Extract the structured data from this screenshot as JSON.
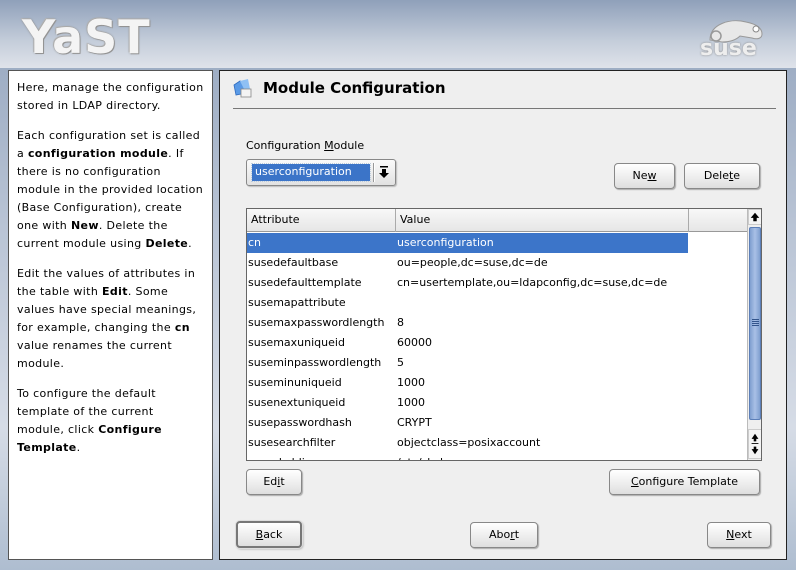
{
  "banner": {
    "app_logo": "YaST",
    "vendor_logo": "suse"
  },
  "help": {
    "paragraphs": [
      [
        {
          "t": "Here, manage the configuration stored in LDAP directory."
        }
      ],
      [
        {
          "t": "Each configuration set is called a "
        },
        {
          "b": "configuration module"
        },
        {
          "t": ". If there is no configuration module in the provided location (Base Configuration), create one with "
        },
        {
          "b": "New"
        },
        {
          "t": ". Delete the current module using "
        },
        {
          "b": "Delete"
        },
        {
          "t": "."
        }
      ],
      [
        {
          "t": "Edit the values of attributes in the table with "
        },
        {
          "b": "Edit"
        },
        {
          "t": ". Some values have special meanings, for example, changing the "
        },
        {
          "b": "cn"
        },
        {
          "t": " value renames the current module."
        }
      ],
      [
        {
          "t": "To configure the default template of the current module, click "
        },
        {
          "b": "Configure Template"
        },
        {
          "t": "."
        }
      ]
    ]
  },
  "main": {
    "title": "Module Configuration",
    "title_icon": "ldap-config-icon",
    "config_module": {
      "label_pre": "Configuration ",
      "label_mnemonic": "M",
      "label_post": "odule",
      "selected": "userconfiguration"
    },
    "buttons": {
      "new": {
        "pre": "Ne",
        "mn": "w",
        "post": ""
      },
      "delete": {
        "pre": "Dele",
        "mn": "t",
        "post": "e"
      },
      "edit": {
        "pre": "Ed",
        "mn": "i",
        "post": "t"
      },
      "configure_template": {
        "pre": "",
        "mn": "C",
        "post": "onfigure Template"
      }
    },
    "table": {
      "columns": [
        "Attribute",
        "Value"
      ],
      "selected_index": 0,
      "rows": [
        {
          "attribute": "cn",
          "value": "userconfiguration"
        },
        {
          "attribute": "susedefaultbase",
          "value": "ou=people,dc=suse,dc=de"
        },
        {
          "attribute": "susedefaulttemplate",
          "value": "cn=usertemplate,ou=ldapconfig,dc=suse,dc=de"
        },
        {
          "attribute": "susemapattribute",
          "value": ""
        },
        {
          "attribute": "susemaxpasswordlength",
          "value": "8"
        },
        {
          "attribute": "susemaxuniqueid",
          "value": "60000"
        },
        {
          "attribute": "suseminpasswordlength",
          "value": "5"
        },
        {
          "attribute": "suseminuniqueid",
          "value": "1000"
        },
        {
          "attribute": "susenextuniqueid",
          "value": "1000"
        },
        {
          "attribute": "susepasswordhash",
          "value": "CRYPT"
        },
        {
          "attribute": "susesearchfilter",
          "value": "objectclass=posixaccount"
        },
        {
          "attribute": "suseskeldir",
          "value": "/etc/skel"
        }
      ]
    }
  },
  "nav": {
    "back": {
      "pre": "",
      "mn": "B",
      "post": "ack"
    },
    "abort": {
      "pre": "Abo",
      "mn": "r",
      "post": "t"
    },
    "next": {
      "pre": "",
      "mn": "N",
      "post": "ext"
    }
  }
}
